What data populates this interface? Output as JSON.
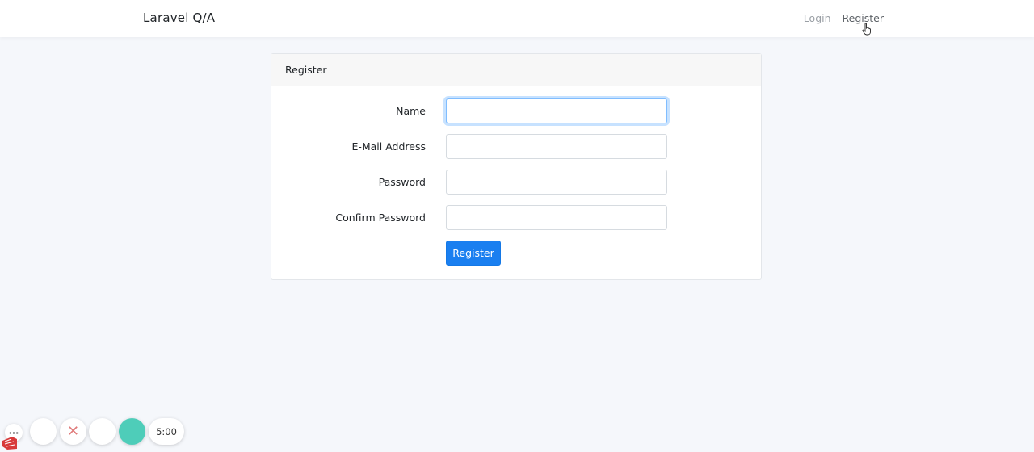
{
  "navbar": {
    "brand": "Laravel Q/A",
    "links": [
      {
        "label": "Login"
      },
      {
        "label": "Register"
      }
    ]
  },
  "card": {
    "title": "Register",
    "fields": [
      {
        "label": "Name",
        "value": "",
        "focused": true
      },
      {
        "label": "E-Mail Address",
        "value": ""
      },
      {
        "label": "Password",
        "value": ""
      },
      {
        "label": "Confirm Password",
        "value": ""
      }
    ],
    "submit_label": "Register"
  },
  "dock": {
    "menu_label": "···",
    "close_label": "✕",
    "timer": "5:00"
  },
  "colors": {
    "accent": "#1a7ff0",
    "record": "#4ecdb9",
    "background": "#f5f7fb"
  }
}
